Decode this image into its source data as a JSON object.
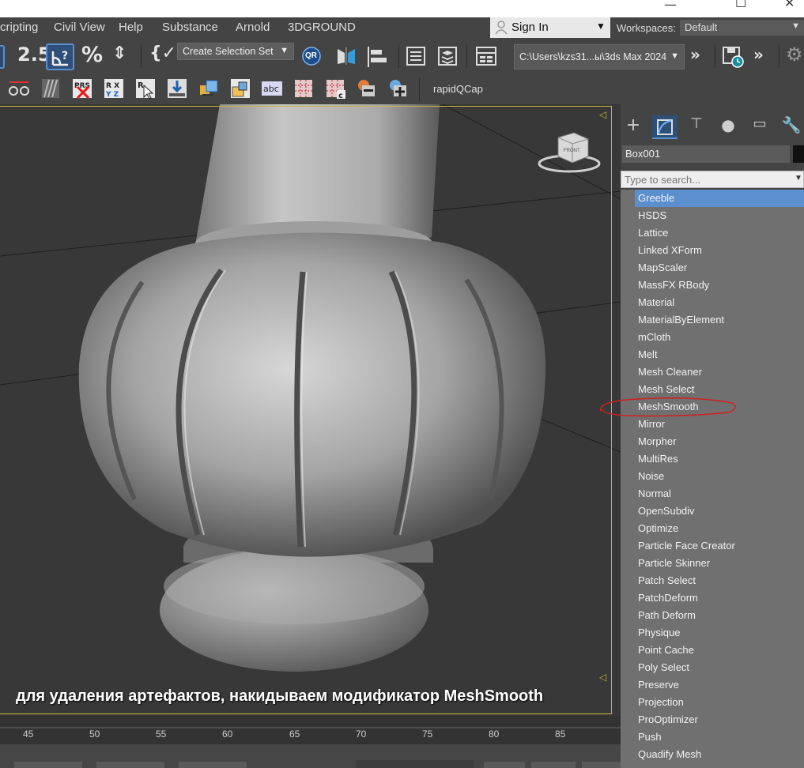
{
  "window": {
    "minimize": "—",
    "maximize": "☐",
    "close": "✕"
  },
  "menu": [
    "cripting",
    "Civil View",
    "Help",
    "Substance",
    "Arnold",
    "3DGROUND"
  ],
  "sign_in": {
    "label": "Sign In",
    "icon": "user-icon"
  },
  "workspaces": {
    "label": "Workspaces:",
    "value": "Default"
  },
  "toolbar1": {
    "selection_set": "Create Selection Set",
    "qr_label": "QR",
    "project_path": "C:\\Users\\kzs31...ы\\3ds Max 2024",
    "snap_label": "2.5",
    "percent": "%"
  },
  "toolbar2": {
    "rapid_label": "rapidQCap"
  },
  "viewport": {
    "caption": "для удаления артефактов, накидываем модификатор MeshSmooth",
    "viewcube_label": "FRONT"
  },
  "timeline": {
    "ticks": [
      "45",
      "50",
      "55",
      "60",
      "65",
      "70",
      "75",
      "80",
      "85"
    ]
  },
  "command_panel": {
    "tabs": [
      "create",
      "modify",
      "hierarchy",
      "motion",
      "display",
      "utilities"
    ],
    "object_name": "Box001",
    "search_placeholder": "Type to search...",
    "modifiers": [
      "Greeble",
      "HSDS",
      "Lattice",
      "Linked XForm",
      "MapScaler",
      "MassFX RBody",
      "Material",
      "MaterialByElement",
      "mCloth",
      "Melt",
      "Mesh Cleaner",
      "Mesh Select",
      "MeshSmooth",
      "Mirror",
      "Morpher",
      "MultiRes",
      "Noise",
      "Normal",
      "OpenSubdiv",
      "Optimize",
      "Particle Face Creator",
      "Particle Skinner",
      "Patch Select",
      "PatchDeform",
      "Path Deform",
      "Physique",
      "Point Cache",
      "Poly Select",
      "Preserve",
      "Projection",
      "ProOptimizer",
      "Push",
      "Quadify Mesh"
    ],
    "selected_modifier": "Greeble",
    "highlighted_modifier": "MeshSmooth"
  },
  "colors": {
    "accent": "#5b8fce",
    "viewport_border": "#c9b13f",
    "annotation": "#d21f1f"
  }
}
